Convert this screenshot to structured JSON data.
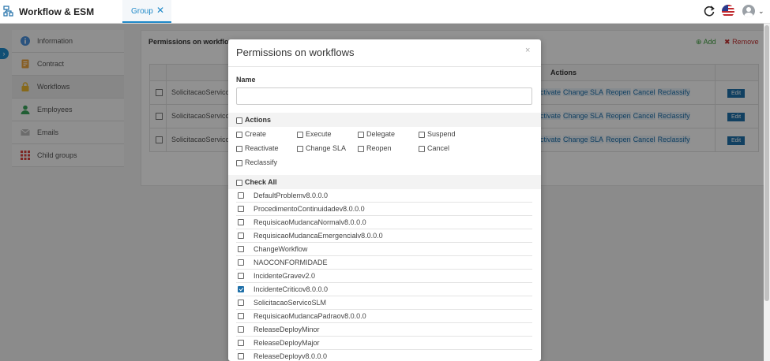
{
  "app": {
    "title": "Workflow & ESM"
  },
  "tabs": [
    {
      "label": "Group",
      "close": "✕"
    }
  ],
  "header": {
    "avatar_caret": "⌄"
  },
  "sidebar": {
    "items": [
      {
        "label": "Information",
        "icon": "info-icon"
      },
      {
        "label": "Contract",
        "icon": "document-icon"
      },
      {
        "label": "Workflows",
        "icon": "lock-icon"
      },
      {
        "label": "Employees",
        "icon": "person-icon"
      },
      {
        "label": "Emails",
        "icon": "envelope-icon"
      },
      {
        "label": "Child groups",
        "icon": "grid-icon"
      }
    ]
  },
  "panel": {
    "title": "Permissions on workflo",
    "add_label": "Add",
    "remove_label": "Remove",
    "grid": {
      "actions_header": "Actions",
      "rows": [
        {
          "name": "SolicitacaoServico",
          "actions": [
            "ctivate",
            "Change SLA",
            "Reopen",
            "Cancel",
            "Reclassify"
          ],
          "edit": "Edit"
        },
        {
          "name": "SolicitacaoServico",
          "actions": [
            "ctivate",
            "Change SLA",
            "Reopen",
            "Cancel",
            "Reclassify"
          ],
          "edit": "Edit"
        },
        {
          "name": "SolicitacaoServico",
          "actions": [
            "ctivate",
            "Change SLA",
            "Reopen",
            "Cancel",
            "Reclassify"
          ],
          "edit": "Edit"
        }
      ]
    }
  },
  "modal": {
    "title": "Permissions on workflows",
    "close": "×",
    "name_label": "Name",
    "name_value": "",
    "actions_label": "Actions",
    "actions": [
      {
        "label": "Create",
        "checked": false
      },
      {
        "label": "Execute",
        "checked": false
      },
      {
        "label": "Delegate",
        "checked": false
      },
      {
        "label": "Suspend",
        "checked": false
      },
      {
        "label": "Reactivate",
        "checked": false
      },
      {
        "label": "Change SLA",
        "checked": false
      },
      {
        "label": "Reopen",
        "checked": false
      },
      {
        "label": "Cancel",
        "checked": false
      },
      {
        "label": "Reclassify",
        "checked": false
      }
    ],
    "check_all_label": "Check All",
    "workflows": [
      {
        "label": "DefaultProblemv8.0.0.0",
        "checked": false
      },
      {
        "label": "ProcedimentoContinuidadev8.0.0.0",
        "checked": false
      },
      {
        "label": "RequisicaoMudancaNormalv8.0.0.0",
        "checked": false
      },
      {
        "label": "RequisicaoMudancaEmergencialv8.0.0.0",
        "checked": false
      },
      {
        "label": "ChangeWorkflow",
        "checked": false
      },
      {
        "label": "NAOCONFORMIDADE",
        "checked": false
      },
      {
        "label": "IncidenteGravev2.0",
        "checked": false
      },
      {
        "label": "IncidenteCriticov8.0.0.0",
        "checked": true
      },
      {
        "label": "SolicitacaoServicoSLM",
        "checked": false
      },
      {
        "label": "RequisicaoMudancaPadraov8.0.0.0",
        "checked": false
      },
      {
        "label": "ReleaseDeployMinor",
        "checked": false
      },
      {
        "label": "ReleaseDeployMajor",
        "checked": false
      },
      {
        "label": "ReleaseDeployv8.0.0.0",
        "checked": false
      }
    ]
  },
  "colors": {
    "accent": "#1e88c8",
    "link": "#1e6fa8",
    "add": "#3a9a3a",
    "remove": "#c03030"
  }
}
